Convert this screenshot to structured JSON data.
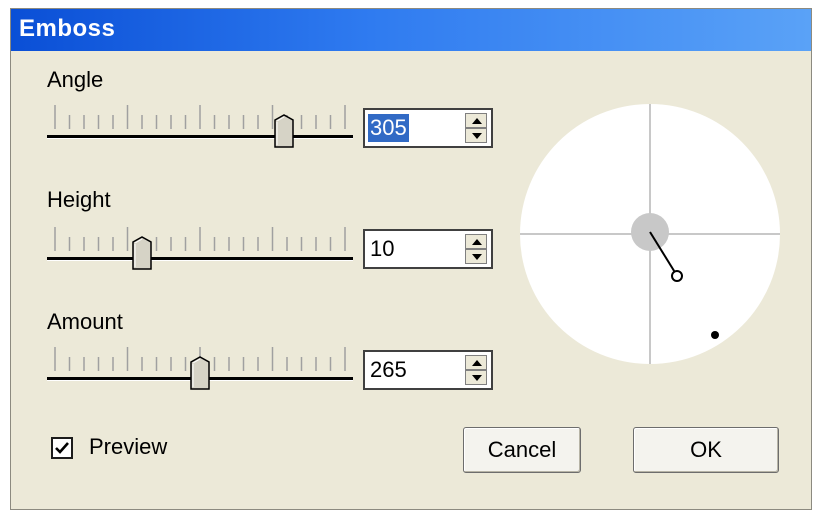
{
  "window": {
    "title": "Emboss"
  },
  "controls": {
    "angle": {
      "label": "Angle",
      "value": "305",
      "slider_fraction": 0.79
    },
    "height": {
      "label": "Height",
      "value": "10",
      "slider_fraction": 0.3
    },
    "amount": {
      "label": "Amount",
      "value": "265",
      "slider_fraction": 0.5
    }
  },
  "preview": {
    "label": "Preview",
    "checked": true
  },
  "buttons": {
    "cancel": "Cancel",
    "ok": "OK"
  },
  "colors": {
    "title_start": "#0a4fd6",
    "title_end": "#5aa2f7",
    "dialog_bg": "#ece9d8",
    "selection": "#316ac5"
  },
  "icons": [
    "spin-up-arrow-icon",
    "spin-down-arrow-icon",
    "checkmark-icon",
    "slider-thumb-icon"
  ]
}
